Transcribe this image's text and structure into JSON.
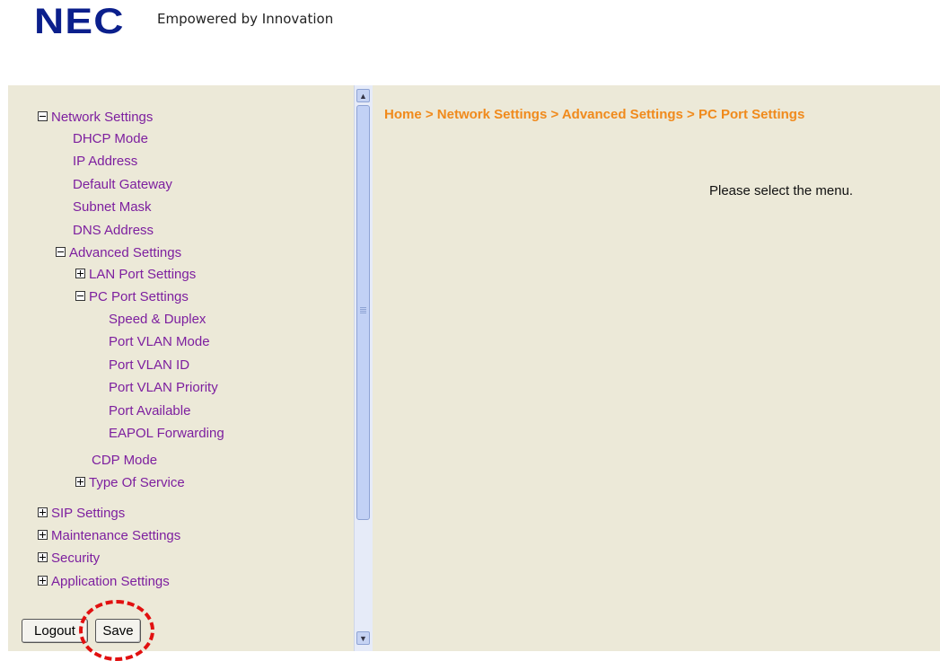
{
  "header": {
    "logo_text": "NEC",
    "tagline": "Empowered by Innovation"
  },
  "tree": [
    {
      "label": "Network Settings",
      "toggle": "minus"
    },
    {
      "label": "DHCP Mode"
    },
    {
      "label": "IP Address"
    },
    {
      "label": "Default Gateway"
    },
    {
      "label": "Subnet Mask"
    },
    {
      "label": "DNS Address"
    },
    {
      "label": "Advanced Settings",
      "toggle": "minus"
    },
    {
      "label": "LAN Port Settings",
      "toggle": "plus"
    },
    {
      "label": "PC Port Settings",
      "toggle": "minus"
    },
    {
      "label": "Speed & Duplex"
    },
    {
      "label": "Port VLAN Mode"
    },
    {
      "label": "Port VLAN ID"
    },
    {
      "label": "Port VLAN Priority"
    },
    {
      "label": "Port Available"
    },
    {
      "label": "EAPOL Forwarding"
    },
    {
      "label": "CDP Mode"
    },
    {
      "label": "Type Of Service",
      "toggle": "plus"
    },
    {
      "label": "SIP Settings",
      "toggle": "plus"
    },
    {
      "label": "Maintenance Settings",
      "toggle": "plus"
    },
    {
      "label": "Security",
      "toggle": "plus"
    },
    {
      "label": "Application Settings",
      "toggle": "plus"
    }
  ],
  "buttons": {
    "logout": "Logout",
    "save": "Save"
  },
  "main": {
    "breadcrumb": "Home > Network Settings > Advanced Settings > PC Port Settings",
    "message": "Please select the menu."
  },
  "colors": {
    "panel_bg": "#ece9d8",
    "link": "#7d1f9f",
    "breadcrumb": "#f08a1c",
    "logo": "#0b1f8c",
    "highlight": "#e11010"
  },
  "icons": {
    "scroll_up": "▲",
    "scroll_down": "▼"
  }
}
